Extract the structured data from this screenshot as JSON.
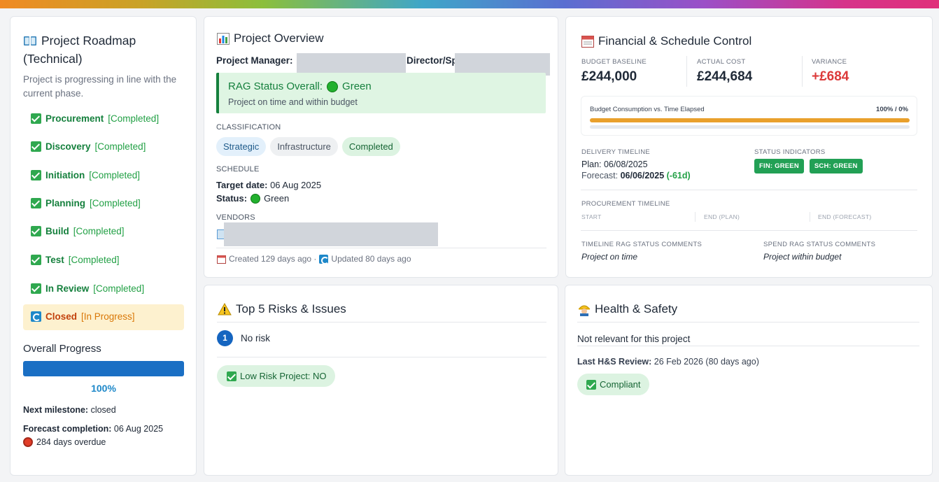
{
  "roadmap": {
    "title_line1": "Project Roadmap",
    "title_line2": "(Technical)",
    "subtitle": "Project is progressing in line with the current phase.",
    "items": [
      {
        "name": "Procurement",
        "status": "[Completed]"
      },
      {
        "name": "Discovery",
        "status": "[Completed]"
      },
      {
        "name": "Initiation",
        "status": "[Completed]"
      },
      {
        "name": "Planning",
        "status": "[Completed]"
      },
      {
        "name": "Build",
        "status": "[Completed]"
      },
      {
        "name": "Test",
        "status": "[Completed]"
      },
      {
        "name": "In Review",
        "status": "[Completed]"
      },
      {
        "name": "Closed",
        "status": "[In Progress]"
      }
    ],
    "overall_progress_label": "Overall Progress",
    "progress_value": 100,
    "progress_text": "100%",
    "next_milestone_label": "Next milestone:",
    "next_milestone_value": "closed",
    "forecast_label": "Forecast completion:",
    "forecast_value": "06 Aug 2025",
    "overdue_text": "284 days overdue"
  },
  "overview": {
    "title": "Project Overview",
    "pm_label": "Project Manager:",
    "director_label": "Director/Sp",
    "rag_title": "RAG Status Overall:",
    "rag_value": "Green",
    "rag_desc": "Project on time and within budget",
    "classification_label": "CLASSIFICATION",
    "tags": [
      "Strategic",
      "Infrastructure",
      "Completed"
    ],
    "schedule_label": "SCHEDULE",
    "target_label": "Target date:",
    "target_value": "06 Aug 2025",
    "status_label": "Status:",
    "status_value": "Green",
    "vendors_label": "VENDORS",
    "created_text": "Created 129 days ago ·",
    "updated_text": "Updated 80 days ago"
  },
  "financial": {
    "title": "Financial & Schedule Control",
    "budget_label": "BUDGET BASELINE",
    "budget_value": "£244,000",
    "actual_label": "ACTUAL COST",
    "actual_value": "£244,684",
    "variance_label": "VARIANCE",
    "variance_value": "+£684",
    "consumption_label": "Budget Consumption vs. Time Elapsed",
    "consumption_value": "100% / 0%",
    "budget_fill": 1.0,
    "time_fill": 0.0,
    "delivery_label": "DELIVERY TIMELINE",
    "plan_label": "Plan:",
    "plan_value": "06/08/2025",
    "forecast_label": "Forecast:",
    "forecast_value": "06/06/2025",
    "forecast_delta": "(-61d)",
    "indicators_label": "STATUS INDICATORS",
    "badges": [
      "FIN: GREEN",
      "SCH: GREEN"
    ],
    "procurement_label": "PROCUREMENT TIMELINE",
    "proc_cols": [
      "START",
      "END (PLAN)",
      "END (FORECAST)"
    ],
    "timeline_comment_label": "TIMELINE RAG STATUS COMMENTS",
    "timeline_comment": "Project on time",
    "spend_comment_label": "SPEND RAG STATUS COMMENTS",
    "spend_comment": "Project within budget"
  },
  "risks": {
    "title": "Top 5 Risks & Issues",
    "items": [
      {
        "num": "1",
        "text": "No risk"
      }
    ],
    "low_risk_label": "Low Risk Project: NO"
  },
  "health": {
    "title": "Health & Safety",
    "relevance": "Not relevant for this project",
    "last_review_label": "Last H&S Review:",
    "last_review_value": "26 Feb 2026 (80 days ago)",
    "compliant_label": "Compliant"
  },
  "colors": {
    "green_text": "#15803d",
    "accent_blue": "#1976d2",
    "variance_red": "#dc3a3a",
    "orange_bar": "#e9a02c"
  }
}
